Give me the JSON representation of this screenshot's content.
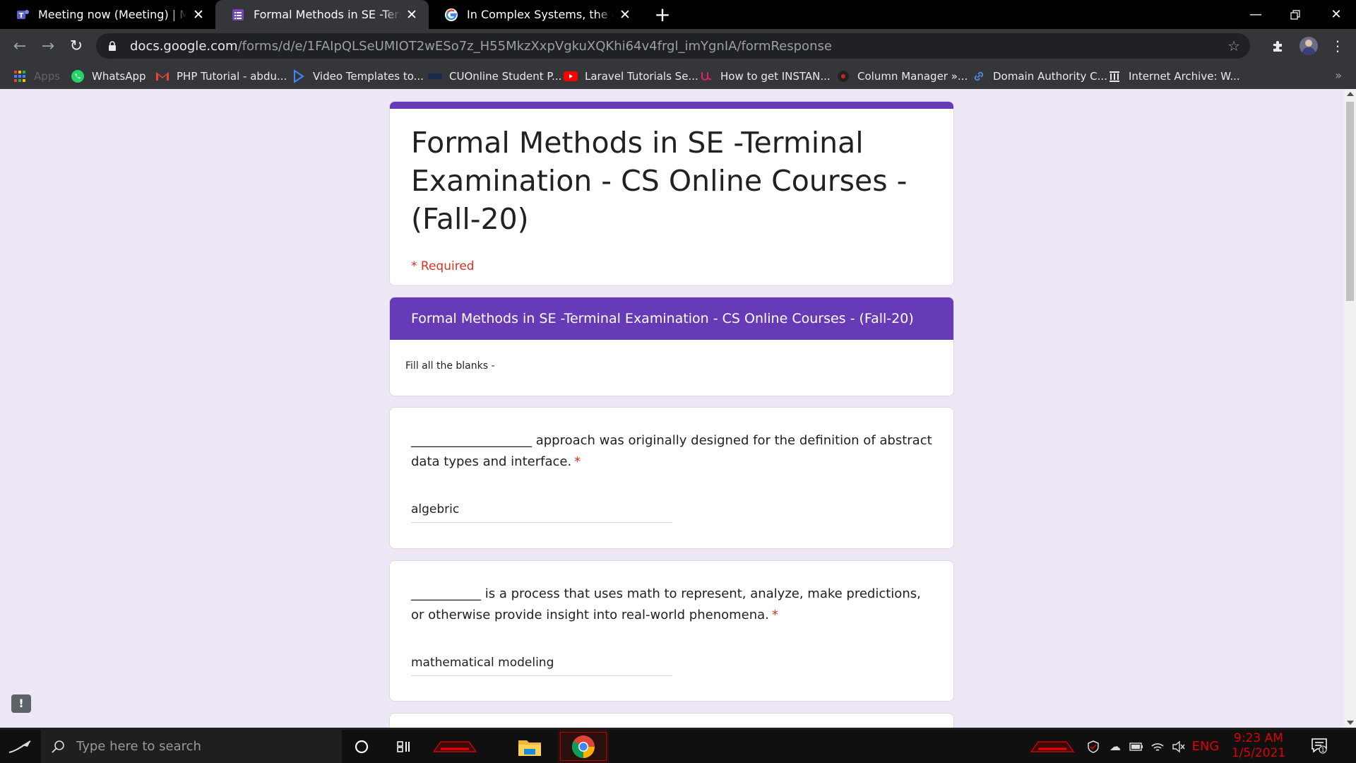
{
  "browser": {
    "tabs": [
      {
        "title": "Meeting now (Meeting) | Microsoft Teams",
        "icon": "teams-icon"
      },
      {
        "title": "Formal Methods in SE -Terminal Examination",
        "icon": "google-forms-icon",
        "active": true
      },
      {
        "title": "In Complex Systems, the output of",
        "icon": "google-icon"
      }
    ],
    "new_tab": "+",
    "url_host": "docs.google.com",
    "url_path": "/forms/d/e/1FAIpQLSeUMIOT2wESo7z_H55MkzXxpVgkuXQKhi64v4frgl_imYgnIA/formResponse",
    "bookmarks": [
      {
        "label": "Apps"
      },
      {
        "label": "WhatsApp"
      },
      {
        "label": "PHP Tutorial - abdu..."
      },
      {
        "label": "Video Templates to..."
      },
      {
        "label": "CUOnline Student P..."
      },
      {
        "label": "Laravel Tutorials Se..."
      },
      {
        "label": "How to get INSTAN..."
      },
      {
        "label": "Column Manager »..."
      },
      {
        "label": "Domain Authority C..."
      },
      {
        "label": "Internet Archive: W..."
      }
    ],
    "bookmarks_more": "»"
  },
  "form": {
    "title": "Formal Methods in SE -Terminal Examination - CS Online Courses - (Fall-20)",
    "required_note": "* Required",
    "section_title": "Formal Methods in SE -Terminal Examination - CS Online Courses - (Fall-20)",
    "section_description": "Fill all the blanks -",
    "questions": [
      {
        "text": "___________________ approach was originally designed for the definition of abstract data types and interface.",
        "required_mark": "*",
        "answer": "algebric"
      },
      {
        "text": "___________ is a process that uses math to represent, analyze, make predictions, or otherwise provide insight into real-world phenomena.",
        "required_mark": "*",
        "answer": "mathematical modeling"
      }
    ],
    "feedback_label": "!"
  },
  "taskbar": {
    "search_placeholder": "Type here to search",
    "language": "ENG",
    "time": "9:23 AM",
    "date": "1/5/2021",
    "notification_count": "1"
  },
  "colors": {
    "form_accent": "#673ab7",
    "required_red": "#d93025",
    "page_background": "#ede7f6",
    "clock_red": "#e00000"
  }
}
